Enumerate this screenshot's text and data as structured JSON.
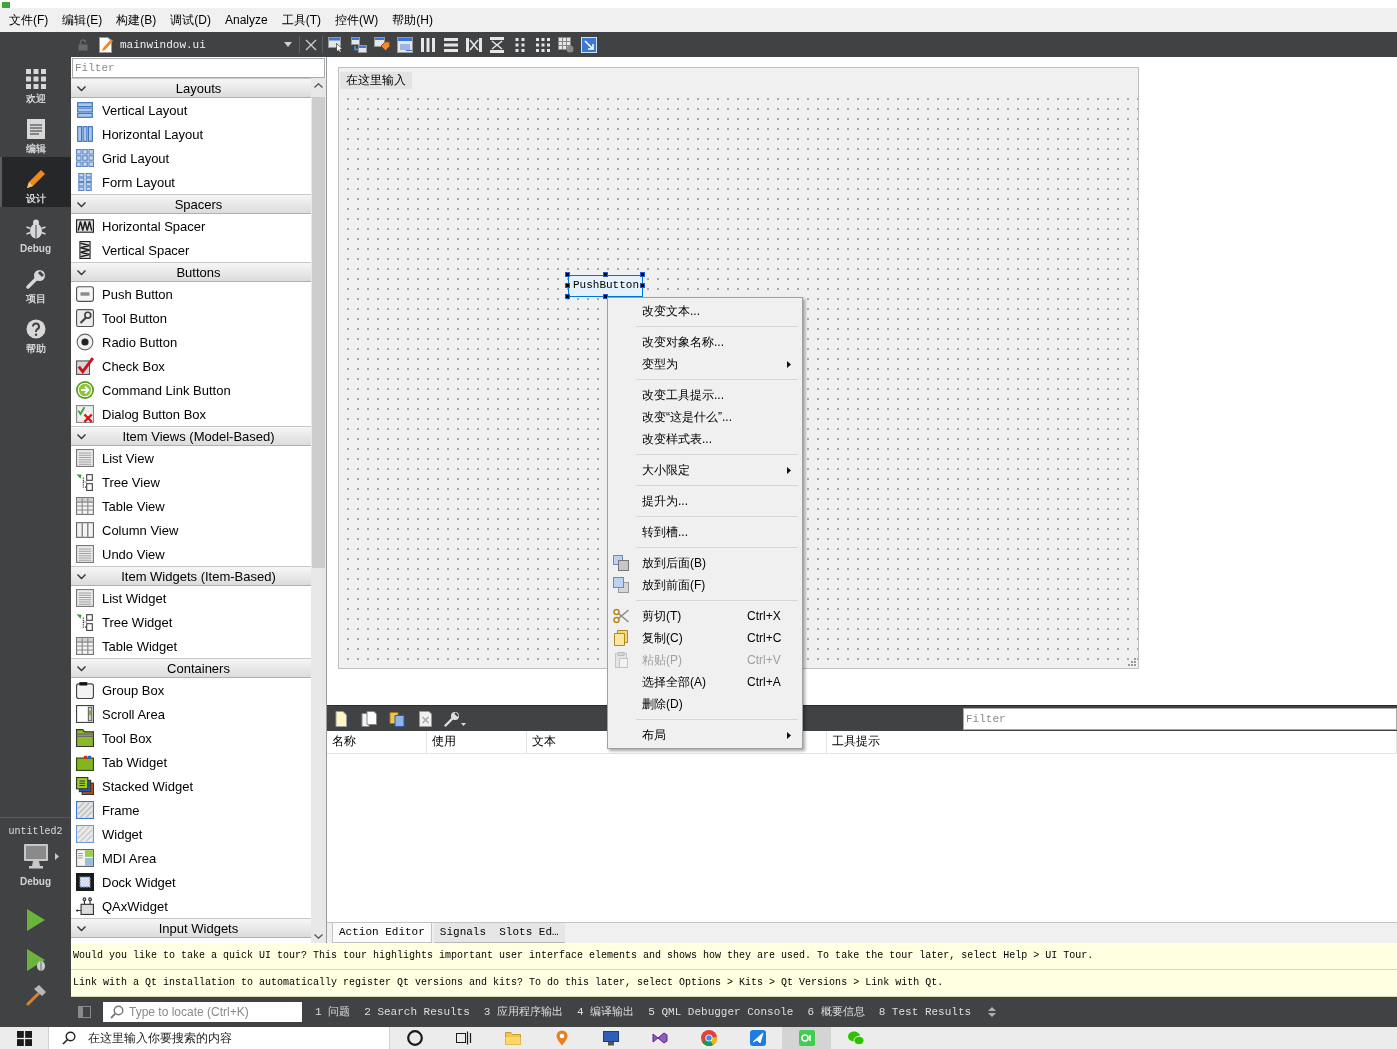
{
  "menu_bar": {
    "items": [
      "文件(F)",
      "编辑(E)",
      "构建(B)",
      "调试(D)",
      "Analyze",
      "工具(T)",
      "控件(W)",
      "帮助(H)"
    ]
  },
  "mode_bar": {
    "modes": [
      {
        "label": "欢迎",
        "selected": false
      },
      {
        "label": "编辑",
        "selected": false
      },
      {
        "label": "设计",
        "selected": true
      },
      {
        "label": "Debug",
        "selected": false
      },
      {
        "label": "项目",
        "selected": false
      },
      {
        "label": "帮助",
        "selected": false
      }
    ],
    "project": "untitled2",
    "build_config": "Debug"
  },
  "editor_toolbar": {
    "document": "mainwindow.ui"
  },
  "widget_box": {
    "filter": {
      "placeholder": "Filter"
    },
    "categories": [
      {
        "title": "Layouts",
        "expanded": true,
        "items": [
          "Vertical Layout",
          "Horizontal Layout",
          "Grid Layout",
          "Form Layout"
        ]
      },
      {
        "title": "Spacers",
        "expanded": true,
        "items": [
          "Horizontal Spacer",
          "Vertical Spacer"
        ]
      },
      {
        "title": "Buttons",
        "expanded": true,
        "items": [
          "Push Button",
          "Tool Button",
          "Radio Button",
          "Check Box",
          "Command Link Button",
          "Dialog Button Box"
        ]
      },
      {
        "title": "Item Views (Model-Based)",
        "expanded": true,
        "items": [
          "List View",
          "Tree View",
          "Table View",
          "Column View",
          "Undo View"
        ]
      },
      {
        "title": "Item Widgets (Item-Based)",
        "expanded": true,
        "items": [
          "List Widget",
          "Tree Widget",
          "Table Widget"
        ]
      },
      {
        "title": "Containers",
        "expanded": true,
        "items": [
          "Group Box",
          "Scroll Area",
          "Tool Box",
          "Tab Widget",
          "Stacked Widget",
          "Frame",
          "Widget",
          "MDI Area",
          "Dock Widget",
          "QAxWidget"
        ]
      },
      {
        "title": "Input Widgets",
        "expanded": true
      }
    ]
  },
  "form": {
    "type_here": "在这里输入",
    "widgets": [
      {
        "kind": "push_button",
        "text": "PushButton",
        "selected": true
      }
    ]
  },
  "context_menu": {
    "items": [
      {
        "kind": "action",
        "label": "改变文本...",
        "disabled": false,
        "submenu": false
      },
      {
        "kind": "separator"
      },
      {
        "kind": "action",
        "label": "改变对象名称...",
        "disabled": false,
        "submenu": false
      },
      {
        "kind": "action",
        "label": "变型为",
        "disabled": false,
        "submenu": true
      },
      {
        "kind": "separator"
      },
      {
        "kind": "action",
        "label": "改变工具提示...",
        "disabled": false,
        "submenu": false
      },
      {
        "kind": "action",
        "label": "改变“这是什么”...",
        "disabled": false,
        "submenu": false
      },
      {
        "kind": "action",
        "label": "改变样式表...",
        "disabled": false,
        "submenu": false
      },
      {
        "kind": "separator"
      },
      {
        "kind": "action",
        "label": "大小限定",
        "disabled": false,
        "submenu": true
      },
      {
        "kind": "separator"
      },
      {
        "kind": "action",
        "label": "提升为...",
        "disabled": false,
        "submenu": false
      },
      {
        "kind": "separator"
      },
      {
        "kind": "action",
        "label": "转到槽...",
        "disabled": false,
        "submenu": false
      },
      {
        "kind": "separator"
      },
      {
        "kind": "action",
        "label": "放到后面(B)",
        "disabled": false,
        "submenu": false
      },
      {
        "kind": "action",
        "label": "放到前面(F)",
        "disabled": false,
        "submenu": false
      },
      {
        "kind": "separator"
      },
      {
        "kind": "action",
        "label": "剪切(T)",
        "shortcut": "Ctrl+X",
        "disabled": false,
        "submenu": false
      },
      {
        "kind": "action",
        "label": "复制(C)",
        "shortcut": "Ctrl+C",
        "disabled": false,
        "submenu": false
      },
      {
        "kind": "action",
        "label": "粘贴(P)",
        "shortcut": "Ctrl+V",
        "disabled": true,
        "submenu": false
      },
      {
        "kind": "action",
        "label": "选择全部(A)",
        "shortcut": "Ctrl+A",
        "disabled": false,
        "submenu": false
      },
      {
        "kind": "action",
        "label": "删除(D)",
        "disabled": false,
        "submenu": false
      },
      {
        "kind": "separator"
      },
      {
        "kind": "action",
        "label": "布局",
        "disabled": false,
        "submenu": true
      }
    ]
  },
  "action_editor": {
    "filter": {
      "placeholder": "Filter"
    },
    "columns": [
      "名称",
      "使用",
      "文本",
      "工具提示"
    ],
    "tabs": [
      {
        "label": "Action Editor",
        "selected": true
      },
      {
        "label": "Signals  Slots Ed…",
        "selected": false
      }
    ]
  },
  "info_bars": [
    "Would you like to take a quick UI tour? This tour highlights important user interface elements and shows how they are used. To take the tour later, select Help > UI Tour.",
    "Link with a Qt installation to automatically register Qt versions and kits? To do this later, select Options > Kits > Qt Versions > Link with Qt."
  ],
  "status_bar": {
    "locate": {
      "placeholder": "Type to locate (Ctrl+K)"
    },
    "panes": [
      "1 问题",
      "2 Search Results",
      "3 应用程序输出",
      "4 编译输出",
      "5 QML Debugger Console",
      "6 概要信息",
      "8 Test Results"
    ]
  },
  "taskbar": {
    "search": {
      "placeholder": "在这里输入你要搜索的内容"
    },
    "apps": [
      {
        "selected": false
      },
      {
        "selected": false
      },
      {
        "selected": false
      },
      {
        "selected": false
      },
      {
        "selected": false
      },
      {
        "selected": false
      },
      {
        "selected": false
      },
      {
        "selected": false
      },
      {
        "selected": true
      },
      {
        "selected": false
      }
    ]
  }
}
